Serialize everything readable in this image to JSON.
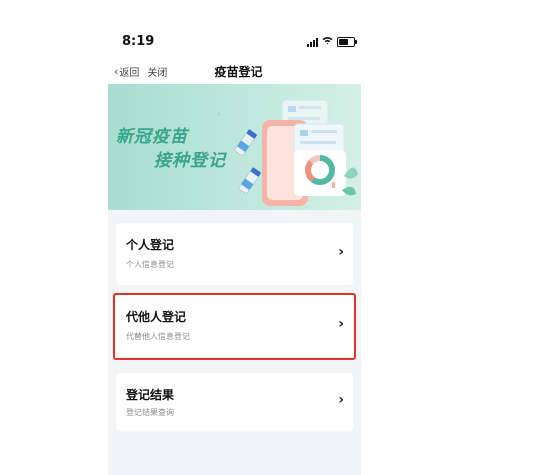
{
  "status_bar": {
    "time": "8:19"
  },
  "nav": {
    "back_label": "返回",
    "close_label": "关闭",
    "title": "疫苗登记"
  },
  "banner": {
    "line1": "新冠疫苗",
    "line2": "接种登记"
  },
  "cards": [
    {
      "title": "个人登记",
      "subtitle": "个人信息登记"
    },
    {
      "title": "代他人登记",
      "subtitle": "代替他人信息登记"
    },
    {
      "title": "登记结果",
      "subtitle": "登记结果查询"
    }
  ],
  "colors": {
    "accent_green": "#3aa58d",
    "highlight_red": "#e0342b",
    "page_bg": "#f3f4f6"
  }
}
